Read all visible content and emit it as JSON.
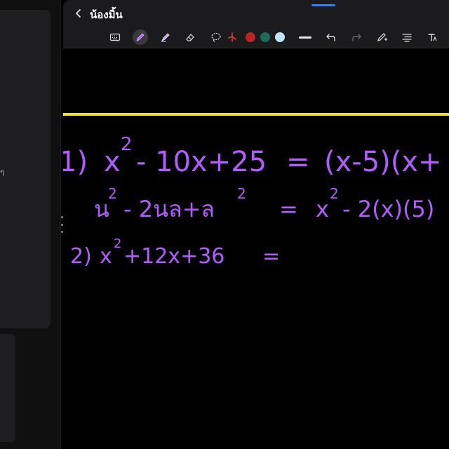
{
  "header": {
    "title": "น้องมิ้น",
    "back_icon": "chevron-left-icon"
  },
  "toolbar": {
    "tools": [
      "keyboard-icon",
      "pen-icon",
      "highlighter-icon",
      "eraser-icon",
      "lasso-icon",
      "laser-pointer-icon",
      "thickness-icon",
      "undo-icon",
      "redo-icon",
      "pen-settings-icon",
      "text-format-icon",
      "text-tool-icon"
    ],
    "colors": [
      "#b8261e",
      "#1e6b57",
      "#bfe3f5"
    ],
    "active_tool": "pen-icon",
    "accent": "#2f7ef4"
  },
  "canvas": {
    "divider_color": "#f4e21d",
    "ink_color": "#b25cff",
    "lines": [
      {
        "label": "1)",
        "expr": "x",
        "sup": "2",
        "rest": "- 10x+25",
        "eq": "=",
        "result": "(x-5)(x+"
      },
      {
        "label": "",
        "expr": "น",
        "sup": "2",
        "rest": "- 2นล+ล",
        "sup2": "2",
        "eq": "=",
        "result": "x",
        "result_sup": "2",
        "result_rest": "- 2(x)(5)"
      },
      {
        "label": "2)",
        "expr": "x",
        "sup": "2",
        "rest": "+12x+36",
        "eq": "="
      }
    ]
  },
  "left_panel": {
    "glyph": "ๆ"
  }
}
